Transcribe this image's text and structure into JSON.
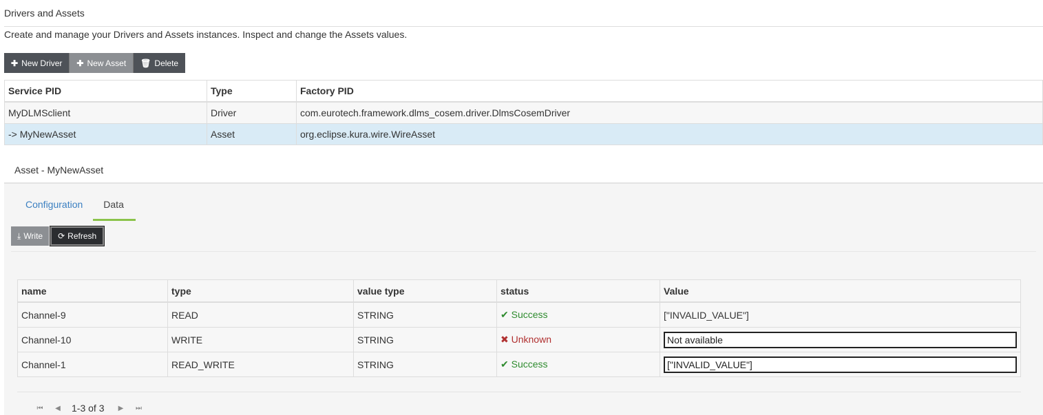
{
  "page": {
    "title": "Drivers and Assets",
    "description": "Create and manage your Drivers and Assets instances. Inspect and change the Assets values."
  },
  "toolbar": {
    "new_driver": "New Driver",
    "new_asset": "New Asset",
    "delete": "Delete"
  },
  "services": {
    "headers": [
      "Service PID",
      "Type",
      "Factory PID"
    ],
    "rows": [
      {
        "pid": "MyDLMSclient",
        "type": "Driver",
        "factory": "com.eurotech.framework.dlms_cosem.driver.DlmsCosemDriver"
      },
      {
        "pid": "-> MyNewAsset",
        "type": "Asset",
        "factory": "org.eclipse.kura.wire.WireAsset"
      }
    ]
  },
  "asset": {
    "title": "Asset - MyNewAsset",
    "tabs": [
      "Configuration",
      "Data"
    ],
    "active_tab": "Data",
    "write_label": "Write",
    "refresh_label": "Refresh",
    "headers": [
      "name",
      "type",
      "value type",
      "status",
      "Value"
    ],
    "rows": [
      {
        "name": "Channel-9",
        "type": "READ",
        "value_type": "STRING",
        "status": "Success",
        "value": "[\"INVALID_VALUE\"]"
      },
      {
        "name": "Channel-10",
        "type": "WRITE",
        "value_type": "STRING",
        "status": "Unknown",
        "value": "Not available"
      },
      {
        "name": "Channel-1",
        "type": "READ_WRITE",
        "value_type": "STRING",
        "status": "Success",
        "value": "[\"INVALID_VALUE\"]"
      }
    ],
    "pager_text": "1-3 of 3"
  },
  "colors": {
    "success": "#2e8b2e",
    "error": "#b03030",
    "tab_accent": "#8bc34a",
    "selected_row": "#d9ebf6"
  }
}
